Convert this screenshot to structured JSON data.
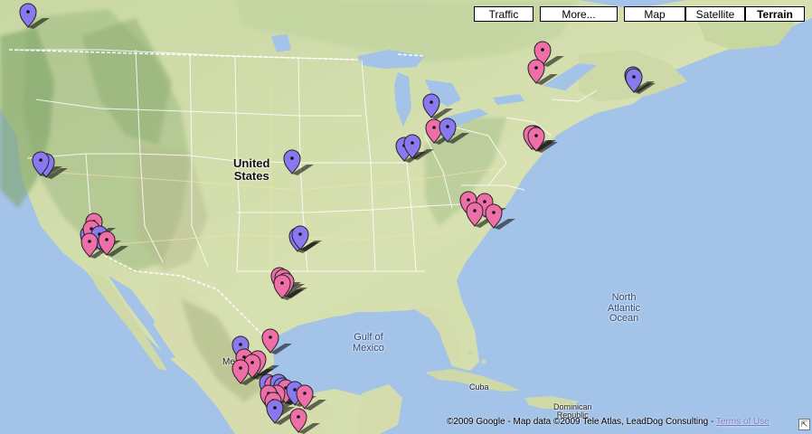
{
  "map_type": "Terrain",
  "controls": {
    "traffic": "Traffic",
    "more": "More...",
    "map": "Map",
    "satellite": "Satellite",
    "terrain": "Terrain"
  },
  "labels": {
    "country": "United\nStates",
    "gulf": "Gulf of\nMexico",
    "ocean": "North\nAtlantic\nOcean",
    "cuba": "Cuba",
    "dominican": "Dominican\nRepublic",
    "mexico": "Me"
  },
  "copyright": {
    "text": "©2009 Google - Map data ©2009 Tele Atlas, LeadDog Consulting - ",
    "terms": "Terms of Use"
  },
  "overview_toggle_icon": "corner-arrow-icon",
  "colors": {
    "water": "#a4c3e8",
    "marker_pink": "#ee6fa8",
    "marker_purple": "#8a78ee"
  },
  "marker_count": 62
}
